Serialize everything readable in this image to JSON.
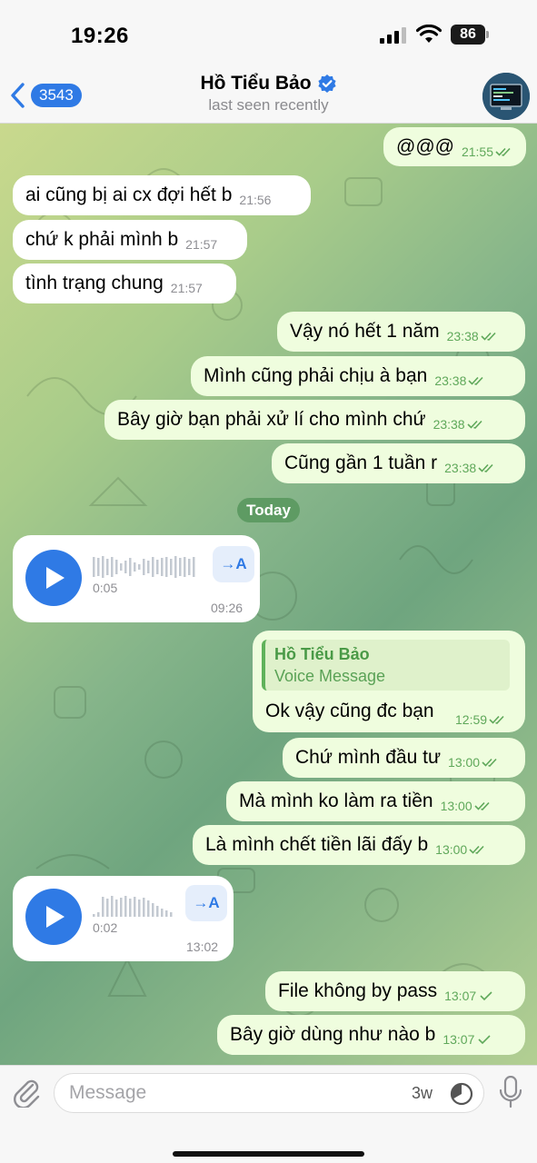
{
  "status_bar": {
    "time": "19:26",
    "battery": "86"
  },
  "header": {
    "back_count": "3543",
    "title": "Hồ Tiểu Bảo",
    "subtitle": "last seen recently"
  },
  "chat": {
    "date_separator": "Today",
    "messages": [
      {
        "text": "@@@",
        "time": "21:55"
      },
      {
        "text": "ai cũng bị ai cx đợi hết b",
        "time": "21:56"
      },
      {
        "text": "chứ k phải mình b",
        "time": "21:57"
      },
      {
        "text": "tình trạng chung",
        "time": "21:57"
      },
      {
        "text": "Vậy nó hết 1 năm",
        "time": "23:38"
      },
      {
        "text": "Mình cũng phải chịu à bạn",
        "time": "23:38"
      },
      {
        "text": "Bây giờ bạn phải xử lí cho mình chứ",
        "time": "23:38"
      },
      {
        "text": "Cũng gần 1 tuần r",
        "time": "23:38"
      },
      {
        "text": "Ok vậy cũng đc bạn",
        "time": "12:59",
        "reply_name": "Hồ Tiểu Bảo",
        "reply_text": "Voice Message"
      },
      {
        "text": "Chứ mình đầu tư",
        "time": "13:00"
      },
      {
        "text": "Mà mình ko làm ra tiền",
        "time": "13:00"
      },
      {
        "text": "Là mình chết tiền lãi đấy b",
        "time": "13:00"
      },
      {
        "text": "File không by pass",
        "time": "13:07"
      },
      {
        "text": "Bây giờ dùng như nào b",
        "time": "13:07"
      }
    ],
    "voice_messages": [
      {
        "duration": "0:05",
        "time": "09:26",
        "transcribe_label": "→A"
      },
      {
        "duration": "0:02",
        "time": "13:02",
        "transcribe_label": "→A"
      }
    ]
  },
  "input_bar": {
    "placeholder": "Message",
    "timer_label": "3w"
  },
  "colors": {
    "accent": "#2f7ae5",
    "outgoing_bubble": "#effdde",
    "incoming_bubble": "#ffffff",
    "outgoing_meta": "#5fa85a",
    "date_pill": "#5e9b63"
  },
  "icons": [
    "back-chevron-icon",
    "verified-icon",
    "attach-icon",
    "timer-icon",
    "mic-icon",
    "play-icon",
    "double-check-icon",
    "single-check-icon",
    "signal-icon",
    "wifi-icon"
  ]
}
